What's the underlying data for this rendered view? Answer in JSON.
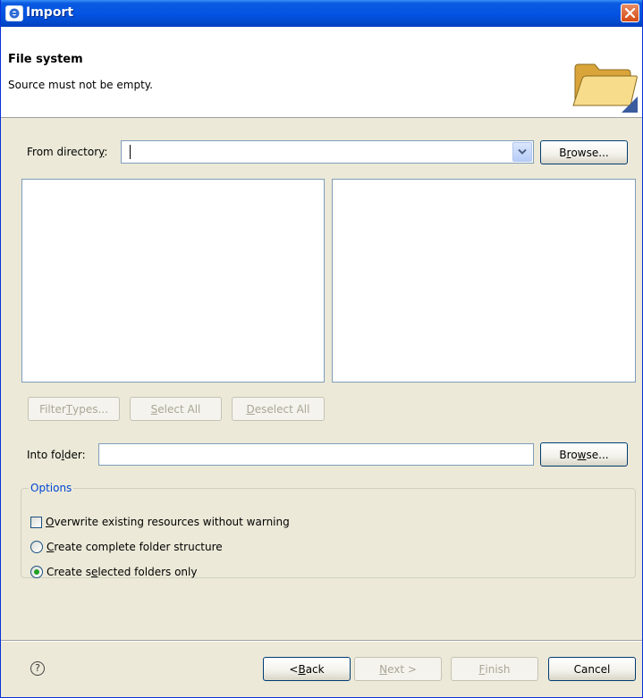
{
  "window": {
    "title": "Import",
    "close_label": "✕"
  },
  "header": {
    "title": "File system",
    "message": "Source must not be empty."
  },
  "source": {
    "label_pre": "From director",
    "label_ul": "y",
    "label_post": ":",
    "value": "",
    "browse_pre": "B",
    "browse_ul": "r",
    "browse_post": "owse..."
  },
  "selection_buttons": {
    "filter": {
      "pre": "Filter ",
      "ul": "T",
      "post": "ypes..."
    },
    "select_all": {
      "pre": "",
      "ul": "S",
      "post": "elect All"
    },
    "deselect_all": {
      "pre": "",
      "ul": "D",
      "post": "eselect All"
    }
  },
  "target": {
    "label_pre": "Into fo",
    "label_ul": "l",
    "label_post": "der:",
    "value": "",
    "browse_pre": "Bro",
    "browse_ul": "w",
    "browse_post": "se..."
  },
  "options": {
    "legend": "Options",
    "overwrite": {
      "pre": "",
      "ul": "O",
      "post": "verwrite existing resources without warning",
      "checked": false
    },
    "complete_structure": {
      "pre": "",
      "ul": "C",
      "post": "reate complete folder structure",
      "selected": false
    },
    "selected_only": {
      "pre": "Create s",
      "ul": "e",
      "post": "lected folders only",
      "selected": true
    }
  },
  "footer": {
    "help_icon": "?",
    "back": {
      "pre": "< ",
      "ul": "B",
      "post": "ack"
    },
    "next": {
      "pre": "",
      "ul": "N",
      "post": "ext >"
    },
    "finish": {
      "pre": "",
      "ul": "F",
      "post": "inish"
    },
    "cancel": "Cancel"
  },
  "colors": {
    "titlebar": "#0554e3",
    "dialog_bg": "#ece9d8",
    "legend": "#0046d5",
    "close": "#d44a14"
  }
}
